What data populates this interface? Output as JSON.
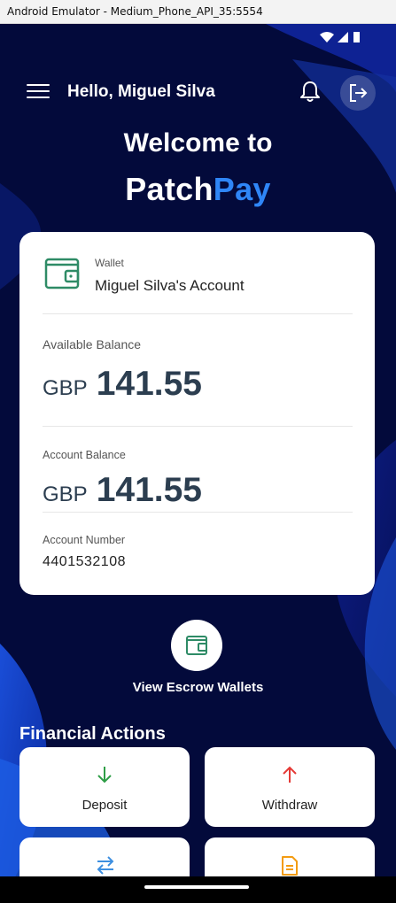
{
  "window": {
    "title": "Android Emulator - Medium_Phone_API_35:5554"
  },
  "header": {
    "greeting": "Hello, Miguel Silva"
  },
  "hero": {
    "welcome": "Welcome to",
    "brand_part1": "Patch",
    "brand_part2": "Pay"
  },
  "wallet": {
    "label": "Wallet",
    "name": "Miguel Silva's Account",
    "available_label": "Available Balance",
    "available_currency": "GBP",
    "available_amount": "141.55",
    "account_balance_label": "Account Balance",
    "account_currency": "GBP",
    "account_amount": "141.55",
    "account_number_label": "Account Number",
    "account_number": "4401532108"
  },
  "escrow": {
    "label": "View Escrow Wallets"
  },
  "actions": {
    "title": "Financial Actions",
    "items": [
      {
        "label": "Deposit",
        "icon": "arrow-down-icon",
        "color": "#2e9e46"
      },
      {
        "label": "Withdraw",
        "icon": "arrow-up-icon",
        "color": "#e53935"
      },
      {
        "label": "",
        "icon": "transfer-icon",
        "color": "#3d8fe0"
      },
      {
        "label": "",
        "icon": "document-icon",
        "color": "#f39c12"
      }
    ]
  },
  "colors": {
    "background": "#030a3b",
    "accent": "#2f86f7",
    "wallet_green": "#2e8b66",
    "amount_text": "#2c3e50"
  }
}
